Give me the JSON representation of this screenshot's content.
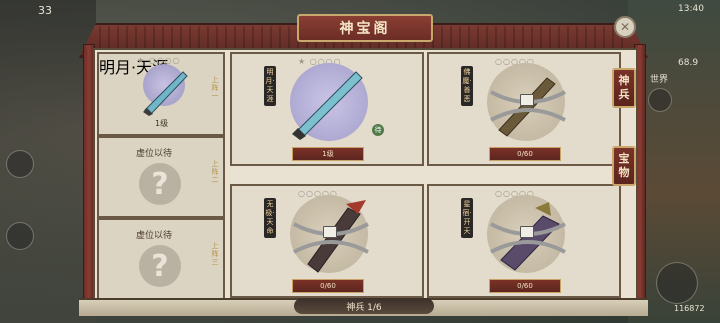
{
  "window": {
    "title": "神宝阁"
  },
  "hud": {
    "top_left_number": "33",
    "time": "13:40",
    "signal": "68.9",
    "world_label": "世界",
    "bottom_right_number": "116872"
  },
  "left_slots": [
    {
      "name": "",
      "vertical_label": "明月·天涯",
      "level": "1级",
      "tag": "上阵一"
    },
    {
      "name": "虚位以待",
      "tag": "上阵二"
    },
    {
      "name": "虚位以待",
      "tag": "上阵三"
    }
  ],
  "cards": [
    {
      "vertical_label": "明月·天涯",
      "footer": "1级",
      "pips": "★ ○○○○",
      "extra": "待"
    },
    {
      "vertical_label": "佛魔·善恶",
      "footer": "0/60",
      "pips": "○○○○○"
    },
    {
      "vertical_label": "无极·天命",
      "footer": "0/60",
      "pips": "○○○○○"
    },
    {
      "vertical_label": "星宿·开天",
      "footer": "0/60",
      "pips": "○○○○○"
    }
  ],
  "side_tabs": [
    {
      "label": "神兵"
    },
    {
      "label": "宝物"
    }
  ],
  "footer": {
    "label": "神兵 1/6"
  },
  "colors": {
    "accent": "#7a3229",
    "gold": "#c9a86c",
    "paper": "#e9e2d2"
  }
}
